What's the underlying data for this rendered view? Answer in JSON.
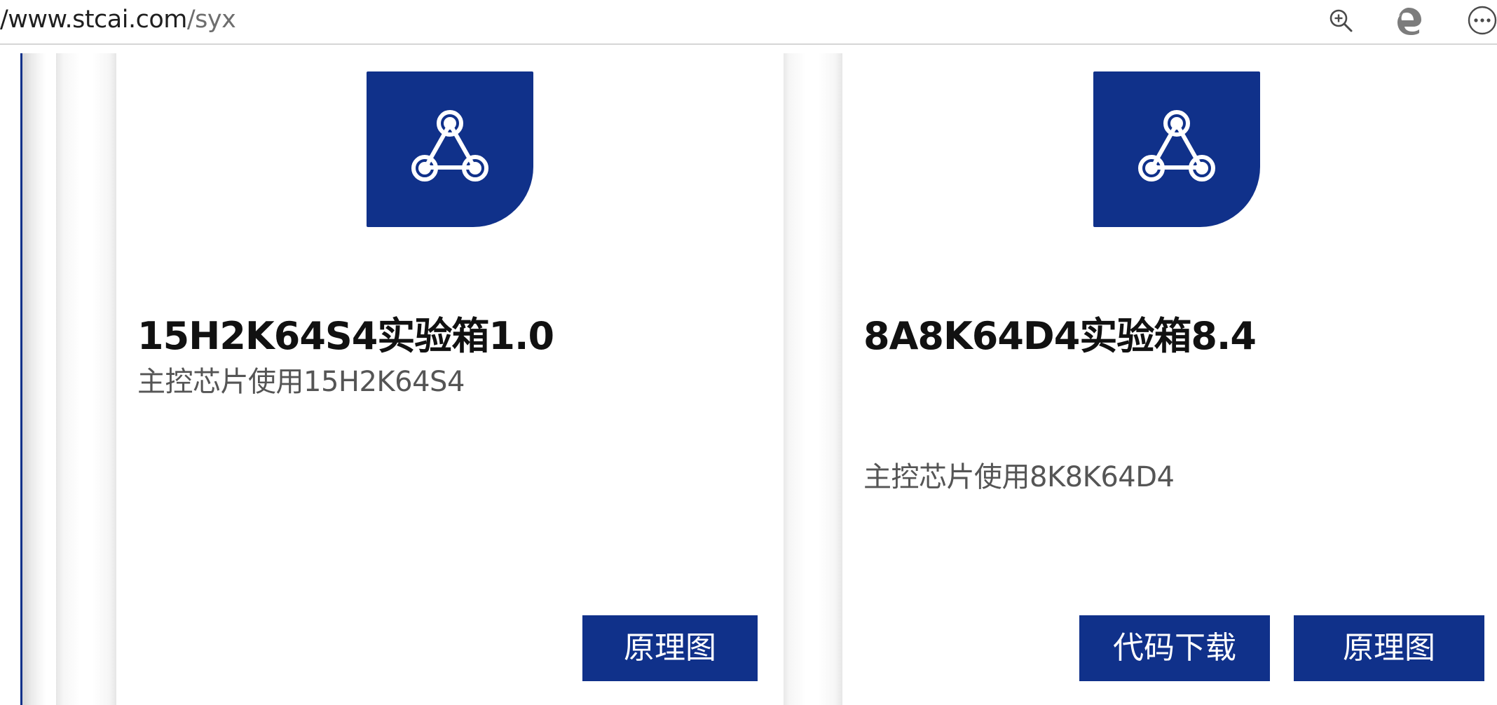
{
  "browser": {
    "url_host": "/www.stcai.com",
    "url_path": "/syx",
    "icons": [
      "zoom-in-icon",
      "edge-icon",
      "more-options-icon"
    ]
  },
  "colors": {
    "brand": "#10318a",
    "title": "#111111",
    "description": "#555555"
  },
  "cards": [
    {
      "icon": "network-triangle-icon",
      "title": "15H2K64S4实验箱1.0",
      "description": "主控芯片使用15H2K64S4",
      "buttons": [
        "原理图"
      ]
    },
    {
      "icon": "network-triangle-icon",
      "title": "8A8K64D4实验箱8.4",
      "description": "主控芯片使用8K8K64D4",
      "buttons": [
        "代码下载",
        "原理图"
      ]
    }
  ]
}
